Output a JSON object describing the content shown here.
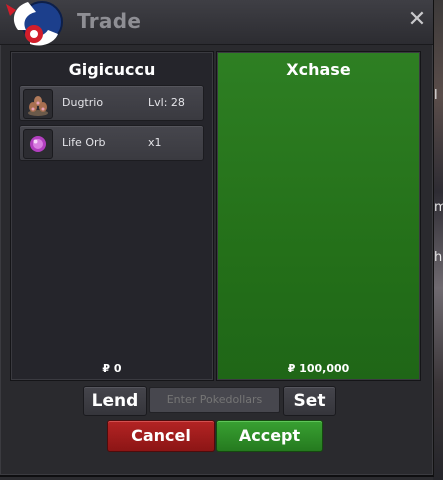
{
  "window": {
    "title": "Trade",
    "close_icon": "✕"
  },
  "left_panel": {
    "player": "Gigicuccu",
    "items": [
      {
        "icon": "dugtrio-sprite-icon",
        "name": "Dugtrio",
        "detail": "Lvl: 28"
      },
      {
        "icon": "life-orb-icon",
        "name": "Life Orb",
        "detail": "x1"
      }
    ],
    "money": "₽ 0"
  },
  "right_panel": {
    "player": "Xchase",
    "items": [],
    "money": "₽ 100,000",
    "accent": "#2a7a20"
  },
  "controls": {
    "lend_label": "Lend",
    "money_placeholder": "Enter Pokedollars",
    "set_label": "Set",
    "cancel_label": "Cancel",
    "accept_label": "Accept"
  },
  "colors": {
    "cancel": "#a01d1d",
    "accept": "#2f8f28",
    "panel_bg": "#25252b"
  }
}
